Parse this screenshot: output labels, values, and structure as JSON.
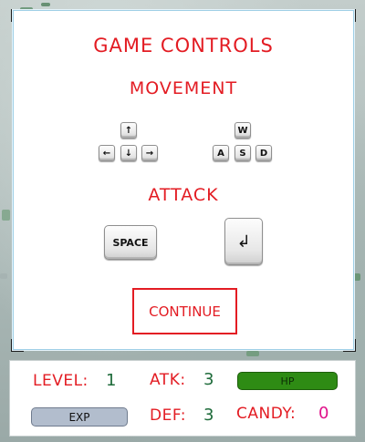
{
  "modal": {
    "title": "GAME CONTROLS",
    "movement_heading": "MOVEMENT",
    "attack_heading": "ATTACK",
    "arrow_keys": [
      {
        "name": "up",
        "glyph": "↑"
      },
      {
        "name": "left",
        "glyph": "←"
      },
      {
        "name": "down",
        "glyph": "↓"
      },
      {
        "name": "right",
        "glyph": "→"
      }
    ],
    "wasd_keys": [
      "W",
      "A",
      "S",
      "D"
    ],
    "space_key": "SPACE",
    "enter_key_glyph": "↲",
    "continue_label": "CONTINUE"
  },
  "hud": {
    "level_label": "LEVEL:",
    "level_value": "1",
    "atk_label": "ATK:",
    "atk_value": "3",
    "hp_label": "HP",
    "hp_fraction": 1.0,
    "exp_label": "EXP",
    "def_label": "DEF:",
    "def_value": "3",
    "candy_label": "CANDY:",
    "candy_value": "0"
  },
  "colors": {
    "heading_red": "#e31c23",
    "stat_green": "#1e6b3a",
    "candy_pink": "#e0128a",
    "hp_green": "#2e8b14",
    "exp_grey_blue": "#b2bdcd"
  }
}
